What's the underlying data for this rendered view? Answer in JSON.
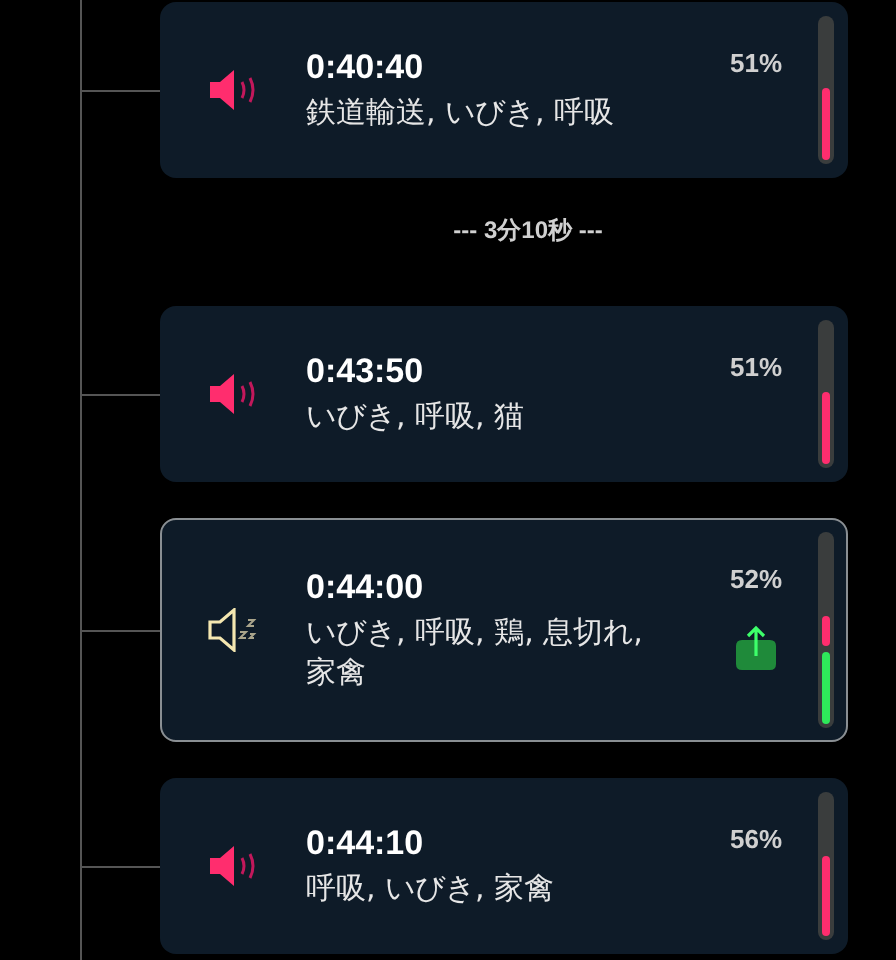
{
  "events": [
    {
      "kind": "card",
      "muted": false,
      "time": "0:40:40",
      "labels": "鉄道輸送, いびき, 呼吸",
      "percent": "51%",
      "selected": false,
      "share": false,
      "meter": {
        "level": 0.52
      }
    },
    {
      "kind": "gap",
      "text": "--- 3分10秒 ---"
    },
    {
      "kind": "card",
      "muted": false,
      "time": "0:43:50",
      "labels": "いびき, 呼吸, 猫",
      "percent": "51%",
      "selected": false,
      "share": false,
      "meter": {
        "level": 0.52
      }
    },
    {
      "kind": "card",
      "muted": true,
      "time": "0:44:00",
      "labels": "いびき, 呼吸, 鶏, 息切れ, 家禽",
      "percent": "52%",
      "selected": true,
      "share": true,
      "meter": {
        "recorded": {
          "level": 0.38
        }
      }
    },
    {
      "kind": "card",
      "muted": false,
      "time": "0:44:10",
      "labels": "呼吸, いびき, 家禽",
      "percent": "56%",
      "selected": false,
      "share": false,
      "meter": {
        "level": 0.57
      }
    }
  ]
}
